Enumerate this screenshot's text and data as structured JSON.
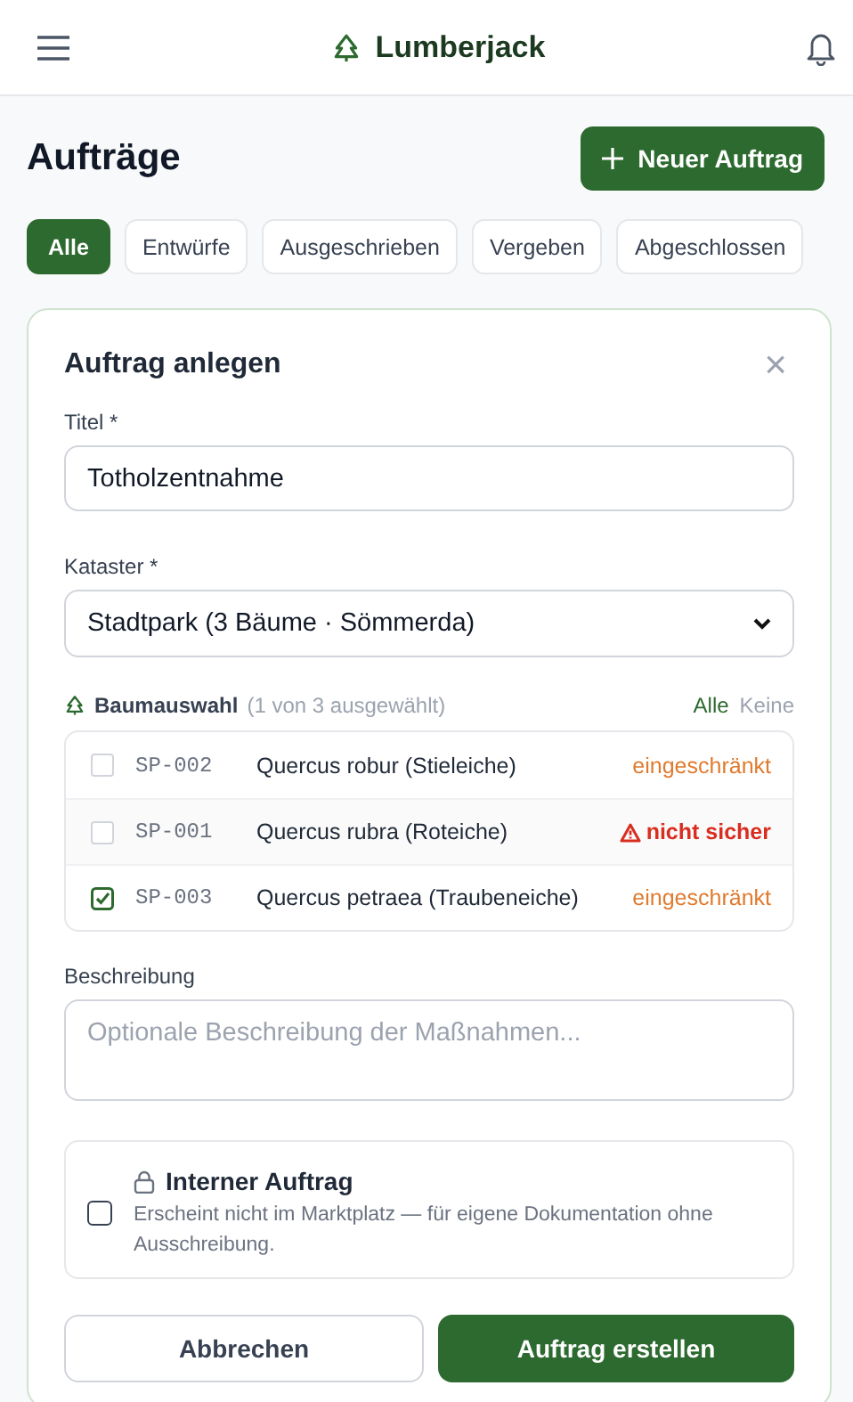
{
  "header": {
    "title": "Lumberjack"
  },
  "page": {
    "title": "Aufträge",
    "new_button": "Neuer Auftrag"
  },
  "filters": [
    {
      "label": "Alle",
      "selected": true
    },
    {
      "label": "Entwürfe",
      "selected": false
    },
    {
      "label": "Ausgeschrieben",
      "selected": false
    },
    {
      "label": "Vergeben",
      "selected": false
    },
    {
      "label": "Abgeschlossen",
      "selected": false
    }
  ],
  "form": {
    "title": "Auftrag anlegen",
    "close": "×",
    "title_field": {
      "label": "Titel *",
      "value": "Totholzentnahme"
    },
    "cadastre_field": {
      "label": "Kataster *",
      "value": "Stadtpark (3 Bäume · Sömmerda)"
    },
    "tree_selection": {
      "label": "Baumauswahl",
      "count": "(1 von 3 ausgewählt)",
      "all": "Alle",
      "none": "Keine",
      "trees": [
        {
          "id": "SP-002",
          "name": "Quercus robur (Stieleiche)",
          "status": "eingeschränkt",
          "kind": "restricted",
          "checked": false
        },
        {
          "id": "SP-001",
          "name": "Quercus rubra (Roteiche)",
          "status": "nicht sicher",
          "kind": "unsafe",
          "checked": false
        },
        {
          "id": "SP-003",
          "name": "Quercus petraea (Traubeneiche)",
          "status": "eingeschränkt",
          "kind": "restricted",
          "checked": true
        }
      ]
    },
    "description_field": {
      "label": "Beschreibung",
      "placeholder": "Optionale Beschreibung der Maßnahmen..."
    },
    "internal": {
      "title": "Interner Auftrag",
      "text": "Erscheint nicht im Marktplatz — für eigene Dokumentation ohne Ausschreibung.",
      "checked": false
    },
    "cancel": "Abbrechen",
    "submit": "Auftrag erstellen"
  }
}
